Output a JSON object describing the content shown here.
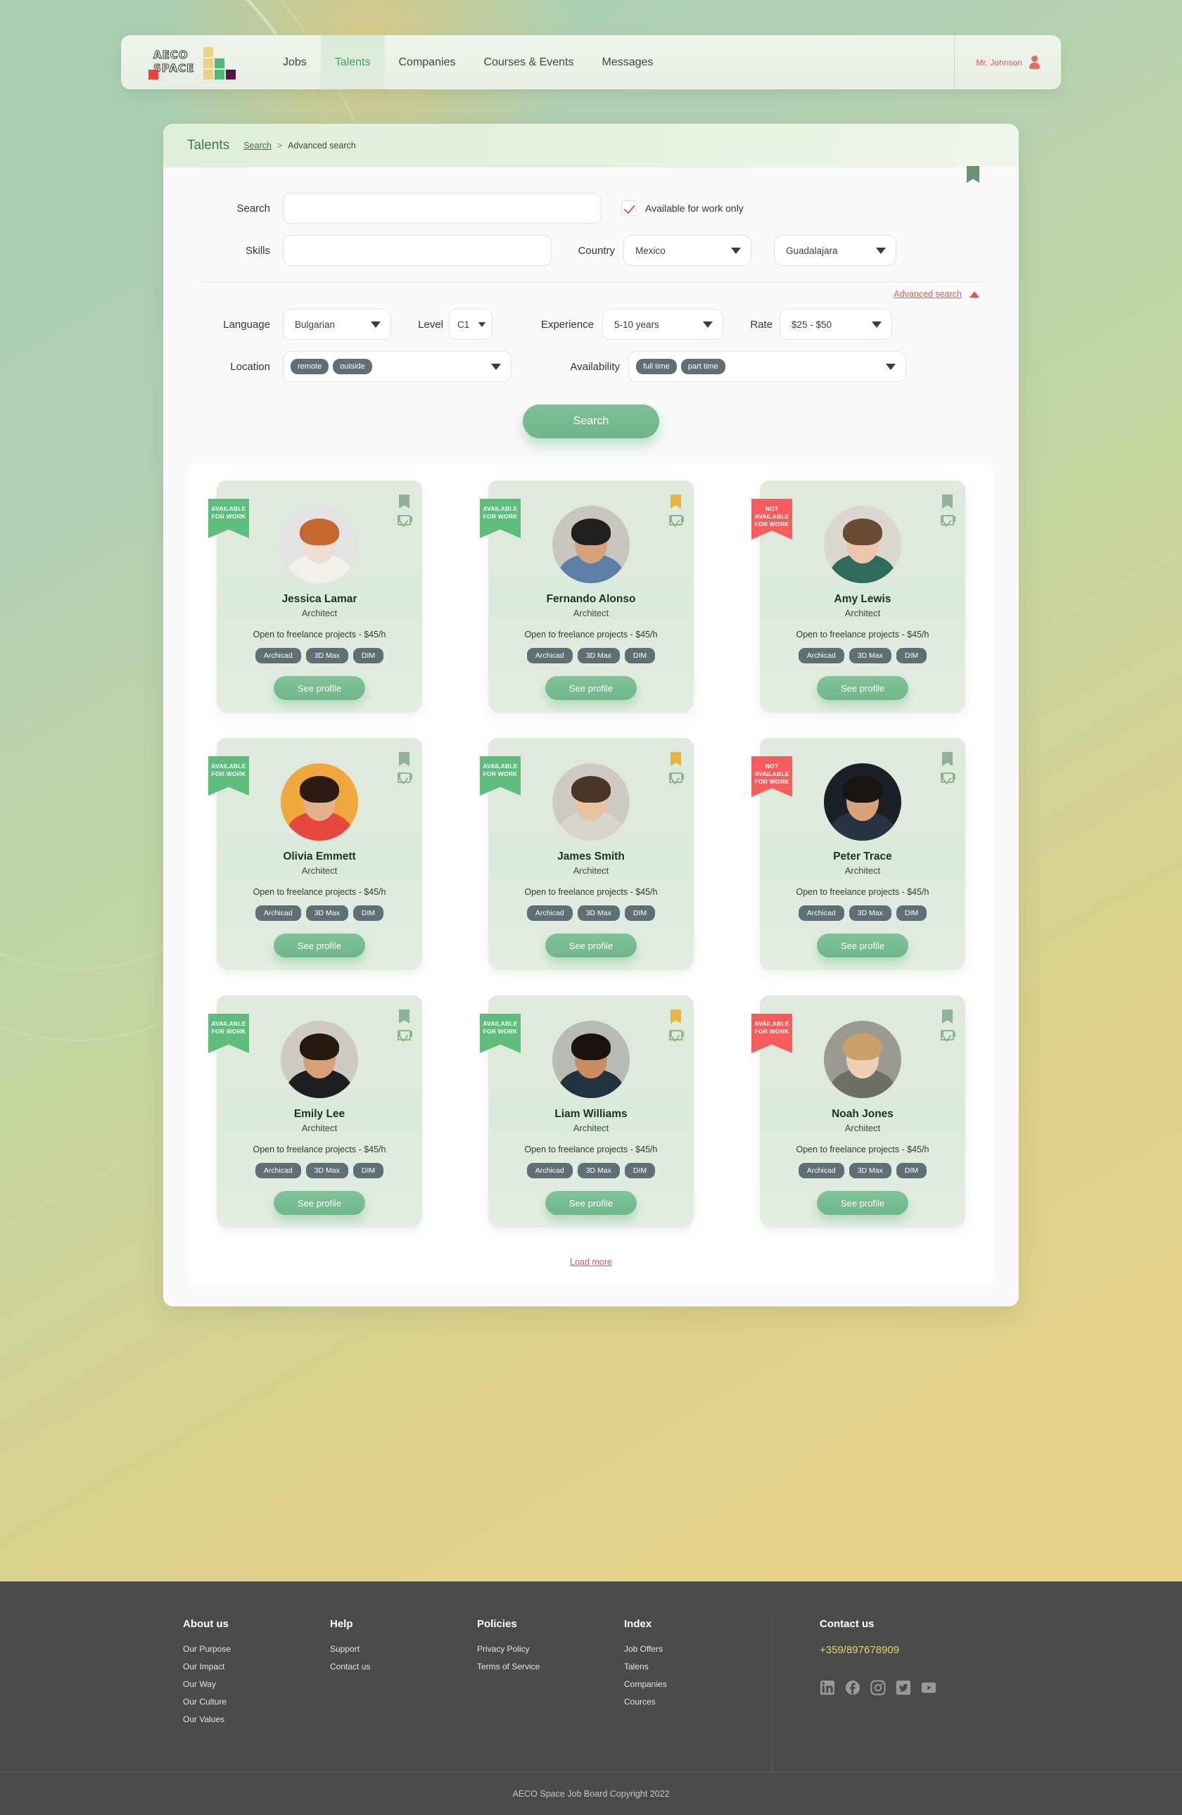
{
  "nav": {
    "logo": {
      "line1": "AECO",
      "line2": "SPACE"
    },
    "links": [
      {
        "label": "Jobs",
        "active": false
      },
      {
        "label": "Talents",
        "active": true
      },
      {
        "label": "Companies",
        "active": false
      },
      {
        "label": "Courses & Events",
        "active": false
      },
      {
        "label": "Messages",
        "active": false
      }
    ],
    "user": "Mr. Johnson"
  },
  "panel": {
    "title": "Talents",
    "breadcrumb": {
      "link": "Search",
      "separator": ">",
      "current": "Advanced search"
    }
  },
  "form": {
    "search_label": "Search",
    "search_value": "",
    "skills_label": "Skills",
    "skills_value": "",
    "country_label": "Country",
    "country_value": "Mexico",
    "city_value": "Guadalajara",
    "available_only_label": "Available for work only",
    "advanced_link": "Advanced search",
    "language_label": "Language",
    "language_value": "Bulgarian",
    "level_label": "Level",
    "level_value": "C1",
    "experience_label": "Experience",
    "experience_value": "5-10 years",
    "rate_label": "Rate",
    "rate_value": "$25 - $50",
    "location_label": "Location",
    "location_tags": [
      "remote",
      "outside"
    ],
    "availability_label": "Availability",
    "availability_tags": [
      "full time",
      "part time"
    ],
    "search_button": "Search"
  },
  "cards": [
    {
      "name": "Jessica Lamar",
      "role": "Architect",
      "ribbon": "AVAILABLE FOR WORK",
      "ribbon_color": "green",
      "bookmark_color": "green",
      "open_text": "Open to freelance projects - $45/h",
      "tags": [
        "Archicad",
        "3D Max",
        "DIM"
      ],
      "button": "See profile",
      "avatar": {
        "skin": "#f0ddd0",
        "hair": "#c4682e",
        "cloth": "#f3f0ec",
        "bg": "#e3e3e3"
      }
    },
    {
      "name": "Fernando Alonso",
      "role": "Architect",
      "ribbon": "AVAILABLE FOR WORK",
      "ribbon_color": "green",
      "bookmark_color": "gold",
      "open_text": "Open to freelance projects - $45/h",
      "tags": [
        "Archicad",
        "3D Max",
        "DIM"
      ],
      "button": "See profile",
      "avatar": {
        "skin": "#d7a277",
        "hair": "#22201e",
        "cloth": "#5b7fa6",
        "bg": "#c9c6c0"
      }
    },
    {
      "name": "Amy Lewis",
      "role": "Architect",
      "ribbon": "NOT AVAILABLE FOR WORK",
      "ribbon_color": "red",
      "bookmark_color": "green",
      "open_text": "Open to freelance projects - $45/h",
      "tags": [
        "Archicad",
        "3D Max",
        "DIM"
      ],
      "button": "See profile",
      "avatar": {
        "skin": "#ecc5ab",
        "hair": "#6a4a33",
        "cloth": "#2e6b5c",
        "bg": "#dcd7cf"
      }
    },
    {
      "name": "Olivia Emmett",
      "role": "Architect",
      "ribbon": "AVAILABLE FOR WORK",
      "ribbon_color": "green",
      "bookmark_color": "green",
      "open_text": "Open to freelance projects - $45/h",
      "tags": [
        "Archicad",
        "3D Max",
        "DIM"
      ],
      "button": "See profile",
      "avatar": {
        "skin": "#e3b28c",
        "hair": "#2a1c12",
        "cloth": "#e8473f",
        "bg": "#f0a83c"
      }
    },
    {
      "name": "James Smith",
      "role": "Architect",
      "ribbon": "AVAILABLE FOR WORK",
      "ribbon_color": "green",
      "bookmark_color": "gold",
      "open_text": "Open to freelance projects - $45/h",
      "tags": [
        "Archicad",
        "3D Max",
        "DIM"
      ],
      "button": "See profile",
      "avatar": {
        "skin": "#e7c4a4",
        "hair": "#4a3526",
        "cloth": "#d9d5cd",
        "bg": "#cfcbc4"
      }
    },
    {
      "name": "Peter Trace",
      "role": "Architect",
      "ribbon": "NOT AVAILABLE FOR WORK",
      "ribbon_color": "red",
      "bookmark_color": "green",
      "open_text": "Open to freelance projects - $45/h",
      "tags": [
        "Archicad",
        "3D Max",
        "DIM"
      ],
      "button": "See profile",
      "avatar": {
        "skin": "#d7a279",
        "hair": "#18140f",
        "cloth": "#2a3342",
        "bg": "#1b1f26"
      }
    },
    {
      "name": "Emily Lee",
      "role": "Architect",
      "ribbon": "AVAILABLE FOR WORK",
      "ribbon_color": "green",
      "bookmark_color": "green",
      "open_text": "Open to freelance projects - $45/h",
      "tags": [
        "Archicad",
        "3D Max",
        "DIM"
      ],
      "button": "See profile",
      "avatar": {
        "skin": "#d9a077",
        "hair": "#241a12",
        "cloth": "#1d1d22",
        "bg": "#cfcac2"
      }
    },
    {
      "name": "Liam Williams",
      "role": "Architect",
      "ribbon": "AVAILABLE FOR WORK",
      "ribbon_color": "green",
      "bookmark_color": "gold",
      "open_text": "Open to freelance projects - $45/h",
      "tags": [
        "Archicad",
        "3D Max",
        "DIM"
      ],
      "button": "See profile",
      "avatar": {
        "skin": "#c98d5f",
        "hair": "#1a120c",
        "cloth": "#23323f",
        "bg": "#b9bcb4"
      }
    },
    {
      "name": "Noah Jones",
      "role": "Architect",
      "ribbon": "AVAILABLE FOR WORK",
      "ribbon_color": "red",
      "bookmark_color": "green",
      "open_text": "Open to freelance projects - $45/h",
      "tags": [
        "Archicad",
        "3D Max",
        "DIM"
      ],
      "button": "See profile",
      "avatar": {
        "skin": "#efd0b6",
        "hair": "#c9a06a",
        "cloth": "#6b6f66",
        "bg": "#9a9a92"
      }
    }
  ],
  "load_more": "Load more",
  "footer": {
    "columns": [
      {
        "heading": "About us",
        "links": [
          "Our Purpose",
          "Our Impact",
          "Our Way",
          "Our Culture",
          "Our Values"
        ]
      },
      {
        "heading": "Help",
        "links": [
          "Support",
          "Contact us"
        ]
      },
      {
        "heading": "Policies",
        "links": [
          "Privacy Policy",
          "Terms of Service"
        ]
      },
      {
        "heading": "Index",
        "links": [
          "Job Offers",
          "Talens",
          "Companies",
          "Cources"
        ]
      }
    ],
    "contact": {
      "heading": "Contact us",
      "phone": "+359/897678909"
    },
    "socials": [
      "linkedin-icon",
      "facebook-icon",
      "instagram-icon",
      "twitter-icon",
      "youtube-icon"
    ],
    "copyright": "AECO Space Job Board Copyright 2022"
  },
  "colors": {
    "accent_green": "#6fb78a",
    "accent_red": "#e8564d",
    "gold": "#e8b63c",
    "tag_gray": "#5e6f76"
  }
}
